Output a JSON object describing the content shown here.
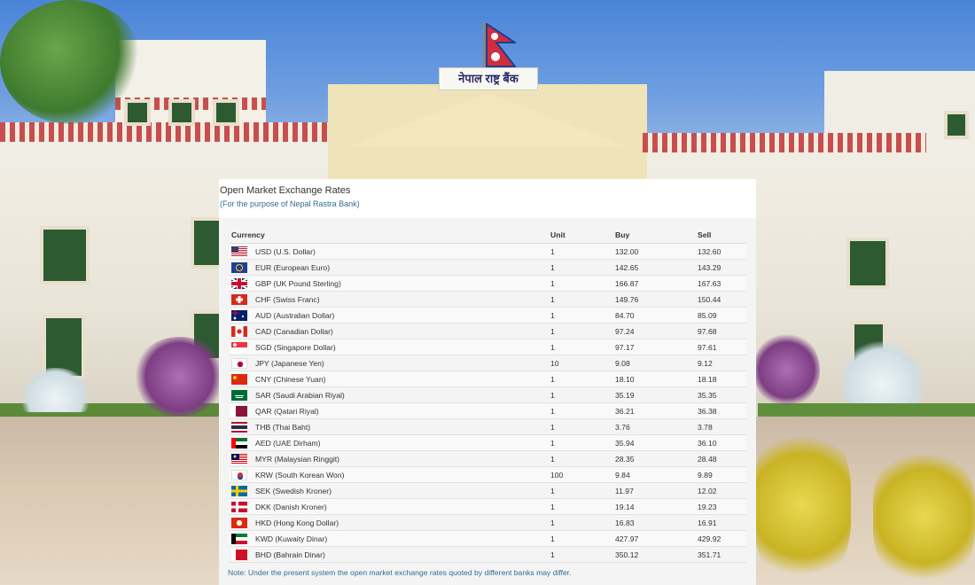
{
  "panel": {
    "title": "Open Market Exchange Rates",
    "subtitle": "(For the purpose of Nepal Rastra Bank)",
    "note": "Note: Under the present system the open market exchange rates quoted by different banks may differ."
  },
  "scene": {
    "sign_text": "नेपाल राष्ट्र बैंक"
  },
  "table": {
    "headers": {
      "currency": "Currency",
      "unit": "Unit",
      "buy": "Buy",
      "sell": "Sell"
    },
    "rows": [
      {
        "flag": "us-flag",
        "currency": "USD (U.S. Dollar)",
        "unit": "1",
        "buy": "132.00",
        "sell": "132.60"
      },
      {
        "flag": "eu-flag",
        "currency": "EUR (European Euro)",
        "unit": "1",
        "buy": "142.65",
        "sell": "143.29"
      },
      {
        "flag": "gb-flag",
        "currency": "GBP (UK Pound Sterling)",
        "unit": "1",
        "buy": "166.87",
        "sell": "167.63"
      },
      {
        "flag": "ch-flag",
        "currency": "CHF (Swiss Franc)",
        "unit": "1",
        "buy": "149.76",
        "sell": "150.44"
      },
      {
        "flag": "au-flag",
        "currency": "AUD (Australian Dollar)",
        "unit": "1",
        "buy": "84.70",
        "sell": "85.09"
      },
      {
        "flag": "ca-flag",
        "currency": "CAD (Canadian Dollar)",
        "unit": "1",
        "buy": "97.24",
        "sell": "97.68"
      },
      {
        "flag": "sg-flag",
        "currency": "SGD (Singapore Dollar)",
        "unit": "1",
        "buy": "97.17",
        "sell": "97.61"
      },
      {
        "flag": "jp-flag",
        "currency": "JPY (Japanese Yen)",
        "unit": "10",
        "buy": "9.08",
        "sell": "9.12"
      },
      {
        "flag": "cn-flag",
        "currency": "CNY (Chinese Yuan)",
        "unit": "1",
        "buy": "18.10",
        "sell": "18.18"
      },
      {
        "flag": "sa-flag",
        "currency": "SAR (Saudi Arabian Riyal)",
        "unit": "1",
        "buy": "35.19",
        "sell": "35.35"
      },
      {
        "flag": "qa-flag",
        "currency": "QAR (Qatari Riyal)",
        "unit": "1",
        "buy": "36.21",
        "sell": "36.38"
      },
      {
        "flag": "th-flag",
        "currency": "THB (Thai Baht)",
        "unit": "1",
        "buy": "3.76",
        "sell": "3.78"
      },
      {
        "flag": "ae-flag",
        "currency": "AED (UAE Dirham)",
        "unit": "1",
        "buy": "35.94",
        "sell": "36.10"
      },
      {
        "flag": "my-flag",
        "currency": "MYR (Malaysian Ringgit)",
        "unit": "1",
        "buy": "28.35",
        "sell": "28.48"
      },
      {
        "flag": "kr-flag",
        "currency": "KRW (South Korean Won)",
        "unit": "100",
        "buy": "9.84",
        "sell": "9.89"
      },
      {
        "flag": "se-flag",
        "currency": "SEK (Swedish Kroner)",
        "unit": "1",
        "buy": "11.97",
        "sell": "12.02"
      },
      {
        "flag": "dk-flag",
        "currency": "DKK (Danish Kroner)",
        "unit": "1",
        "buy": "19.14",
        "sell": "19.23"
      },
      {
        "flag": "hk-flag",
        "currency": "HKD (Hong Kong Dollar)",
        "unit": "1",
        "buy": "16.83",
        "sell": "16.91"
      },
      {
        "flag": "kw-flag",
        "currency": "KWD (Kuwaity Dinar)",
        "unit": "1",
        "buy": "427.97",
        "sell": "429.92"
      },
      {
        "flag": "bh-flag",
        "currency": "BHD (Bahrain Dinar)",
        "unit": "1",
        "buy": "350.12",
        "sell": "351.71"
      }
    ]
  }
}
